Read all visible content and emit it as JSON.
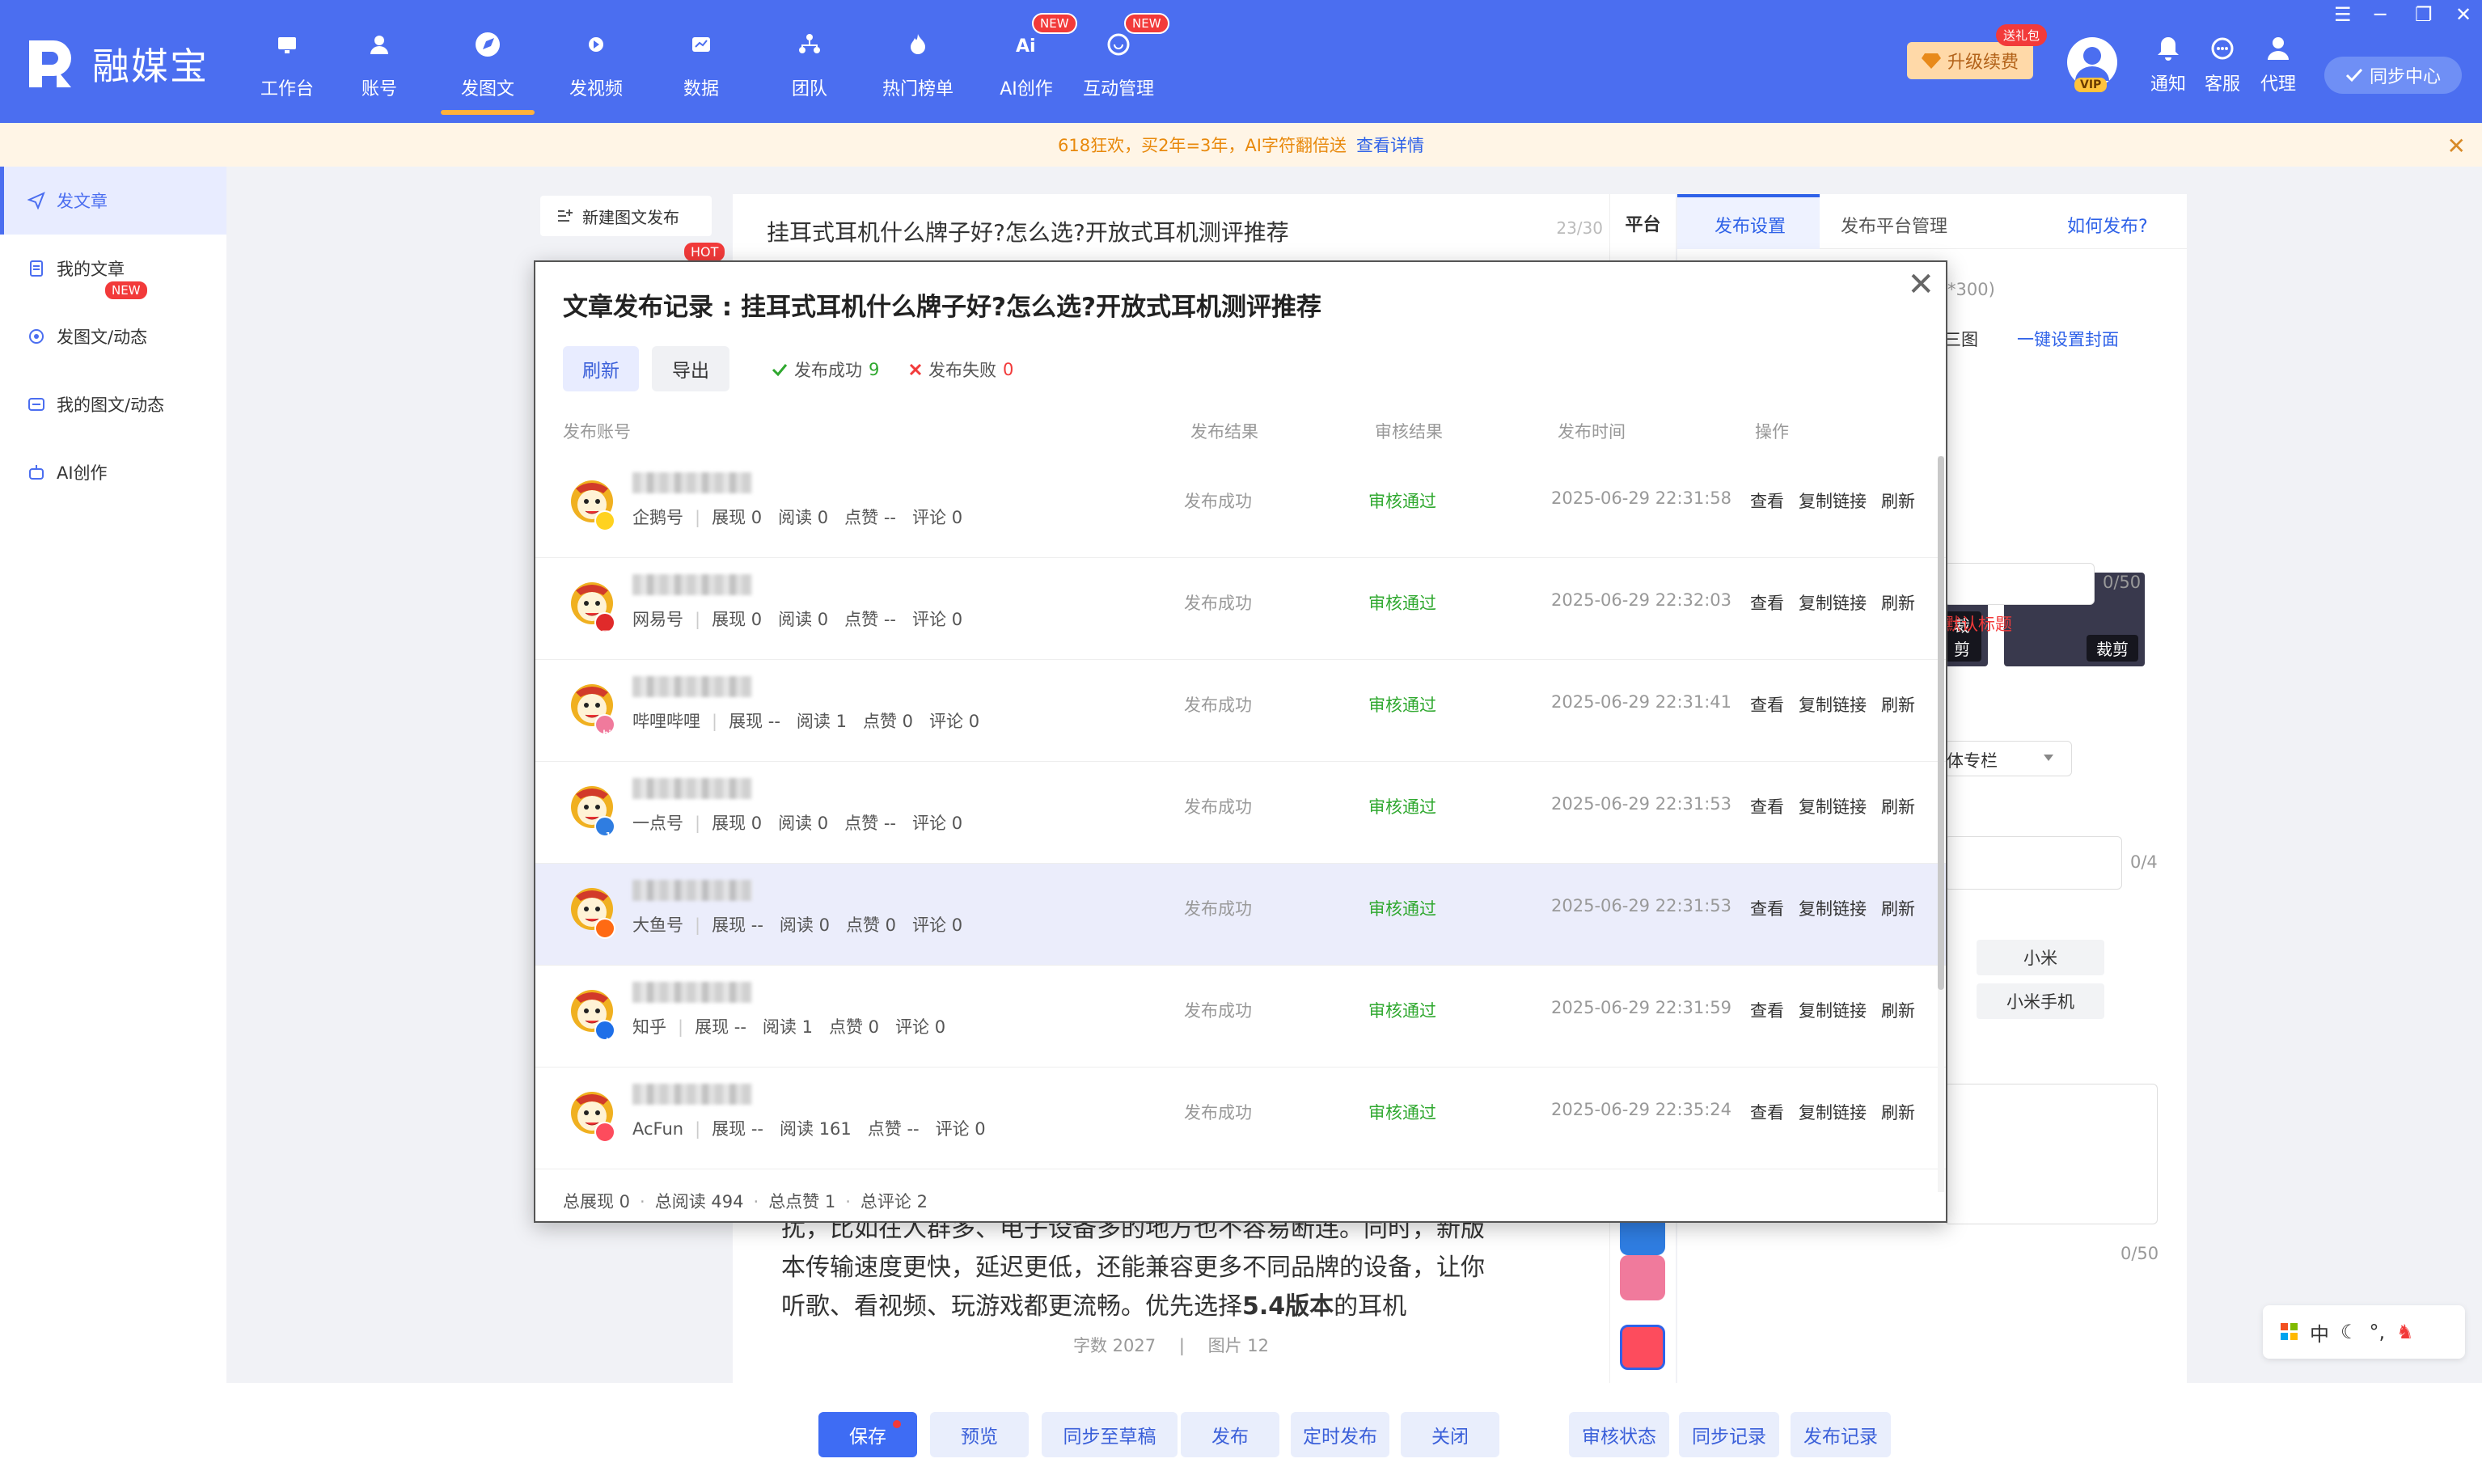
{
  "app": {
    "name": "融媒宝",
    "window_controls": [
      "☰",
      "─",
      "❐",
      "✕"
    ]
  },
  "nav": [
    {
      "label": "工作台",
      "icon": "monitor-icon",
      "active": false,
      "badge": ""
    },
    {
      "label": "账号",
      "icon": "user-icon",
      "active": false,
      "badge": ""
    },
    {
      "label": "发图文",
      "icon": "compass-icon",
      "active": true,
      "badge": ""
    },
    {
      "label": "发视频",
      "icon": "play-icon",
      "active": false,
      "badge": ""
    },
    {
      "label": "数据",
      "icon": "chart-icon",
      "active": false,
      "badge": ""
    },
    {
      "label": "团队",
      "icon": "team-icon",
      "active": false,
      "badge": ""
    },
    {
      "label": "热门榜单",
      "icon": "flame-icon",
      "active": false,
      "badge": ""
    },
    {
      "label": "AI创作",
      "icon": "ai-icon",
      "active": false,
      "badge": "NEW"
    },
    {
      "label": "互动管理",
      "icon": "chat-icon",
      "active": false,
      "badge": "NEW"
    }
  ],
  "topright": {
    "upgrade_label": "升级续费",
    "upgrade_tag": "送礼包",
    "vip_label": "VIP",
    "notice_label": "通知",
    "service_label": "客服",
    "agent_label": "代理",
    "sync_center_label": "同步中心"
  },
  "banner": {
    "text": "618狂欢，买2年=3年，AI字符翻倍送",
    "link": "查看详情",
    "close": "✕"
  },
  "sidebar": {
    "items": [
      {
        "label": "发文章",
        "active": true
      },
      {
        "label": "我的文章",
        "active": false
      },
      {
        "label": "发图文/动态",
        "active": false
      },
      {
        "label": "我的图文/动态",
        "active": false
      },
      {
        "label": "AI创作",
        "active": false
      }
    ],
    "ai_badge": "NEW"
  },
  "workspace": {
    "new_post_label": "新建图文发布",
    "hot_badge": "HOT"
  },
  "editor": {
    "title": "挂耳式耳机什么牌子好?怎么选?开放式耳机测评推荐",
    "title_count": "23/30",
    "body_line1": "扰，比如在人群多、电子设备多的地方也不容易断连。同时，新版",
    "body_line2": "本传输速度更快，延迟更低，还能兼容更多不同品牌的设备，让你",
    "body_line3_a": "听歌、看视频、玩游戏都更流畅。优先选择",
    "body_line3_b": "5.4版本",
    "body_line3_c": "的耳机",
    "word_count": "字数 2027",
    "sep": "|",
    "image_count": "图片 12"
  },
  "platform_col": {
    "title": "平台"
  },
  "settings": {
    "tab_publish": "发布设置",
    "tab_manage": "发布平台管理",
    "how_link": "如何发布?",
    "cover_count": "*300)",
    "three_images": "三图",
    "set_cover_link": "一键设置封面",
    "cut_label": "裁剪",
    "title_limit": "0/50",
    "default_title": "默认标题",
    "column_select": "体专栏",
    "tag_limit": "0/4",
    "tags": [
      "小米",
      "小米手机"
    ],
    "desc_limit": "0/50"
  },
  "bottom": {
    "buttons": [
      "保存",
      "预览",
      "同步至草稿",
      "发布",
      "定时发布",
      "关闭"
    ],
    "right_buttons": [
      "审核状态",
      "同步记录",
      "发布记录"
    ]
  },
  "ime": {
    "lang": "中",
    "moon": "☾",
    "punct": "°,",
    "extra": "♞"
  },
  "modal": {
    "title": "文章发布记录 : 挂耳式耳机什么牌子好?怎么选?开放式耳机测评推荐",
    "close": "✕",
    "refresh_label": "刷新",
    "export_label": "导出",
    "success_label": "发布成功",
    "success_count": "9",
    "fail_label": "发布失败",
    "fail_count": "0",
    "headers": {
      "account": "发布账号",
      "result": "发布结果",
      "audit": "审核结果",
      "time": "发布时间",
      "ops": "操作"
    },
    "rows": [
      {
        "platform": "企鹅号",
        "shown": "展现 0",
        "read": "阅读 0",
        "like": "点赞 --",
        "comment": "评论 0",
        "result": "发布成功",
        "audit": "审核通过",
        "time": "2025-06-29 22:31:58",
        "badge_color": "#ffd21f",
        "badge_text": "",
        "highlight": false
      },
      {
        "platform": "网易号",
        "shown": "展现 0",
        "read": "阅读 0",
        "like": "点赞 --",
        "comment": "评论 0",
        "result": "发布成功",
        "audit": "审核通过",
        "time": "2025-06-29 22:32:03",
        "badge_color": "#e02a2a",
        "badge_text": "网易",
        "highlight": false
      },
      {
        "platform": "哔哩哔哩",
        "shown": "展现 --",
        "read": "阅读 1",
        "like": "点赞 0",
        "comment": "评论 0",
        "result": "发布成功",
        "audit": "审核通过",
        "time": "2025-06-29 22:31:41",
        "badge_color": "#f07a9c",
        "badge_text": "bili",
        "highlight": false
      },
      {
        "platform": "一点号",
        "shown": "展现 0",
        "read": "阅读 0",
        "like": "点赞 --",
        "comment": "评论 0",
        "result": "发布成功",
        "audit": "审核通过",
        "time": "2025-06-29 22:31:53",
        "badge_color": "#2f7de1",
        "badge_text": "1.",
        "highlight": false
      },
      {
        "platform": "大鱼号",
        "shown": "展现 --",
        "read": "阅读 0",
        "like": "点赞 0",
        "comment": "评论 0",
        "result": "发布成功",
        "audit": "审核通过",
        "time": "2025-06-29 22:31:53",
        "badge_color": "#ff6a13",
        "badge_text": "",
        "highlight": true
      },
      {
        "platform": "知乎",
        "shown": "展现 --",
        "read": "阅读 1",
        "like": "点赞 0",
        "comment": "评论 0",
        "result": "发布成功",
        "audit": "审核通过",
        "time": "2025-06-29 22:31:59",
        "badge_color": "#1e6fe8",
        "badge_text": "知",
        "highlight": false
      },
      {
        "platform": "AcFun",
        "shown": "展现 --",
        "read": "阅读 161",
        "like": "点赞 --",
        "comment": "评论 0",
        "result": "发布成功",
        "audit": "审核通过",
        "time": "2025-06-29 22:35:24",
        "badge_color": "#fd4c5d",
        "badge_text": "",
        "highlight": false
      }
    ],
    "ops": [
      "查看",
      "复制链接",
      "刷新"
    ],
    "footer": {
      "shown": "总展现 0",
      "read": "总阅读 494",
      "like": "总点赞 1",
      "comment": "总评论 2",
      "dot": "·"
    }
  },
  "colors": {
    "brand": "#4b6ef0",
    "success": "#2fa82f",
    "danger": "#f23a3a",
    "accent": "#ffb13b"
  }
}
